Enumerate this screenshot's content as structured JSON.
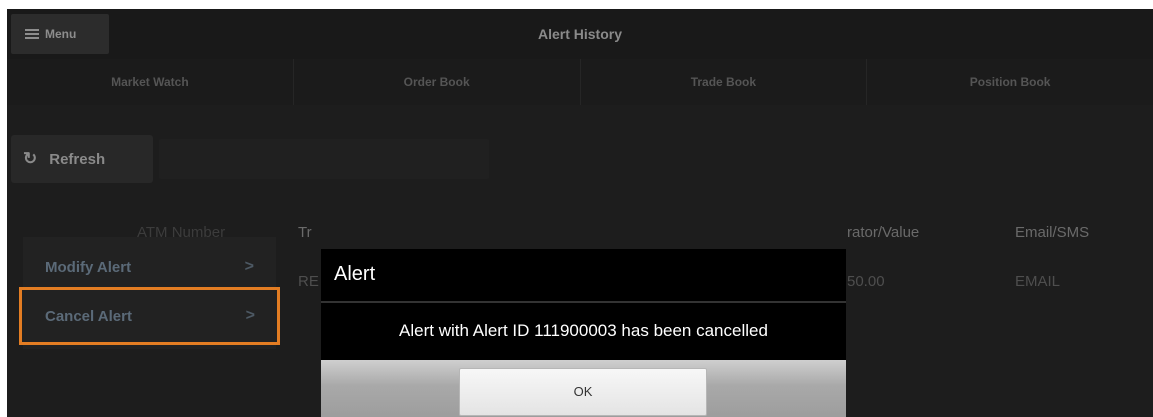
{
  "header": {
    "menu_label": "Menu",
    "title": "Alert History"
  },
  "tabs": [
    {
      "label": "Market Watch"
    },
    {
      "label": "Order Book"
    },
    {
      "label": "Trade Book"
    },
    {
      "label": "Position Book"
    }
  ],
  "toolbar": {
    "refresh_label": "Refresh",
    "search_value": ""
  },
  "table": {
    "headers": {
      "atm_number": "ATM Number",
      "trading_symbol": "Tr",
      "comparator_value": "rator/Value",
      "email_sms": "Email/SMS"
    },
    "row": {
      "trading_symbol": "RE",
      "comparator_value": "50.00",
      "email_sms": "EMAIL"
    }
  },
  "context_menu": {
    "items": [
      {
        "label": "Modify Alert",
        "chevron": ">"
      },
      {
        "label": "Cancel Alert",
        "chevron": ">"
      }
    ]
  },
  "dialog": {
    "title": "Alert",
    "message": "Alert with Alert ID 111900003 has been cancelled",
    "ok_label": "OK"
  },
  "colors": {
    "selection_border": "#e37d23",
    "background": "#1d1d1d",
    "dialog_bg": "#000000"
  }
}
